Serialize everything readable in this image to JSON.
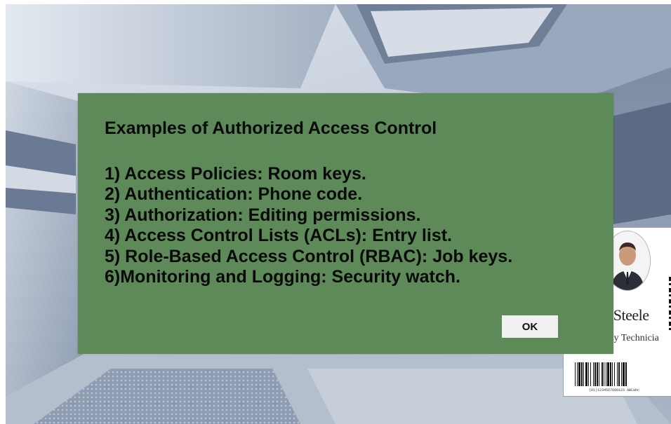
{
  "dialog": {
    "title": "Examples of Authorized Access Control",
    "items": [
      "1) Access Policies: Room keys.",
      "2) Authentication: Phone code.",
      "3) Authorization: Editing permissions.",
      "4) Access Control Lists (ACLs): Entry list.",
      "5) Role-Based Access Control (RBAC): Job keys.",
      "6)Monitoring and Logging: Security watch."
    ],
    "ok_label": "OK",
    "background_color": "#5e8a5a"
  },
  "id_card": {
    "name_fragment": "an Steele",
    "role_fragment": "urity Technicia",
    "barcode_text": "(01)1234567890123 ABCabc"
  }
}
